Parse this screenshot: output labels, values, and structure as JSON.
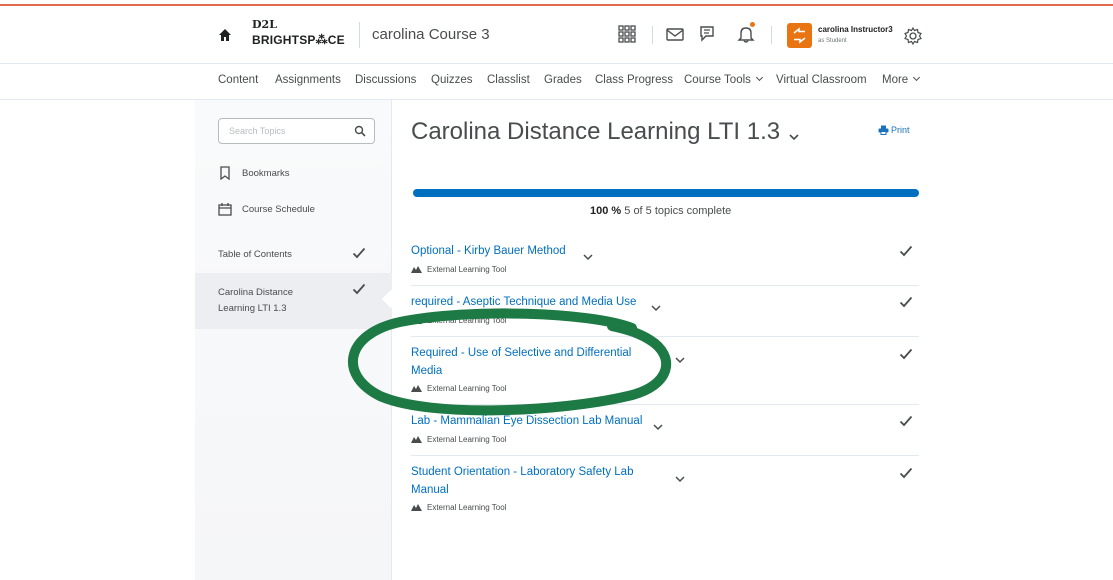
{
  "header": {
    "logo_top": "D2L",
    "logo_bottom": "BRIGHTSP⁂CE",
    "course_name": "carolina Course 3",
    "user_name": "carolina Instructor3",
    "user_role": "as Student",
    "accent_color": "#e87511"
  },
  "nav": {
    "items": [
      "Content",
      "Assignments",
      "Discussions",
      "Quizzes",
      "Classlist",
      "Grades",
      "Class Progress",
      "Course Tools",
      "Virtual Classroom",
      "More"
    ]
  },
  "sidebar": {
    "search_placeholder": "Search Topics",
    "bookmarks": "Bookmarks",
    "course_schedule": "Course Schedule",
    "table_of_contents": "Table of Contents",
    "current_module": "Carolina Distance Learning LTI 1.3"
  },
  "main": {
    "title": "Carolina Distance Learning LTI 1.3",
    "print_label": "Print",
    "progress": {
      "percent_label": "100 %",
      "status": "5 of 5 topics complete",
      "fraction": 1.0,
      "color": "#006fbf"
    },
    "topics": [
      {
        "title": "Optional - Kirby Bauer Method",
        "type": "External Learning Tool"
      },
      {
        "title": "required - Aseptic Technique and Media Use",
        "type": "External Learning Tool"
      },
      {
        "title": "Required - Use of Selective and Differential Media",
        "type": "External Learning Tool"
      },
      {
        "title": "Lab - Mammalian Eye Dissection Lab Manual",
        "type": "External Learning Tool"
      },
      {
        "title": "Student Orientation - Laboratory Safety Lab Manual",
        "type": "External Learning Tool"
      }
    ]
  },
  "annotation_color": "#1e7a45"
}
